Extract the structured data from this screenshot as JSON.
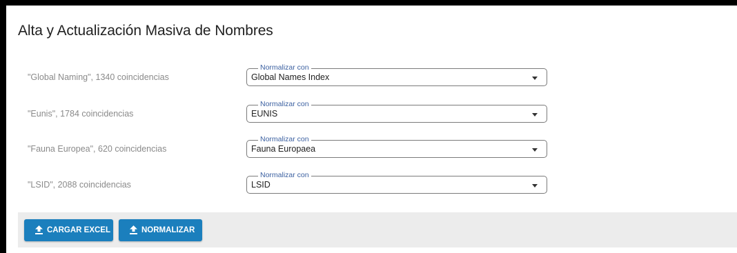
{
  "page": {
    "title": "Alta y Actualización Masiva de Nombres"
  },
  "rows": [
    {
      "label": "\"Global Naming\", 1340 coincidencias",
      "legend": "Normalizar con",
      "value": "Global Names Index"
    },
    {
      "label": "\"Eunis\", 1784 coincidencias",
      "legend": "Normalizar con",
      "value": "EUNIS"
    },
    {
      "label": "\"Fauna Europea\", 620 coincidencias",
      "legend": "Normalizar con",
      "value": "Fauna Europaea"
    },
    {
      "label": "\"LSID\", 2088 coincidencias",
      "legend": "Normalizar con",
      "value": "LSID"
    }
  ],
  "actions": {
    "load_excel": {
      "label": "CARGAR EXCEL",
      "icon": "upload-icon"
    },
    "normalize": {
      "label": "NORMALIZAR",
      "icon": "upload-icon"
    }
  },
  "colors": {
    "primary_button": "#1b7fbd",
    "legend_text": "#3a5fa0",
    "footer_bg": "#ececec"
  }
}
